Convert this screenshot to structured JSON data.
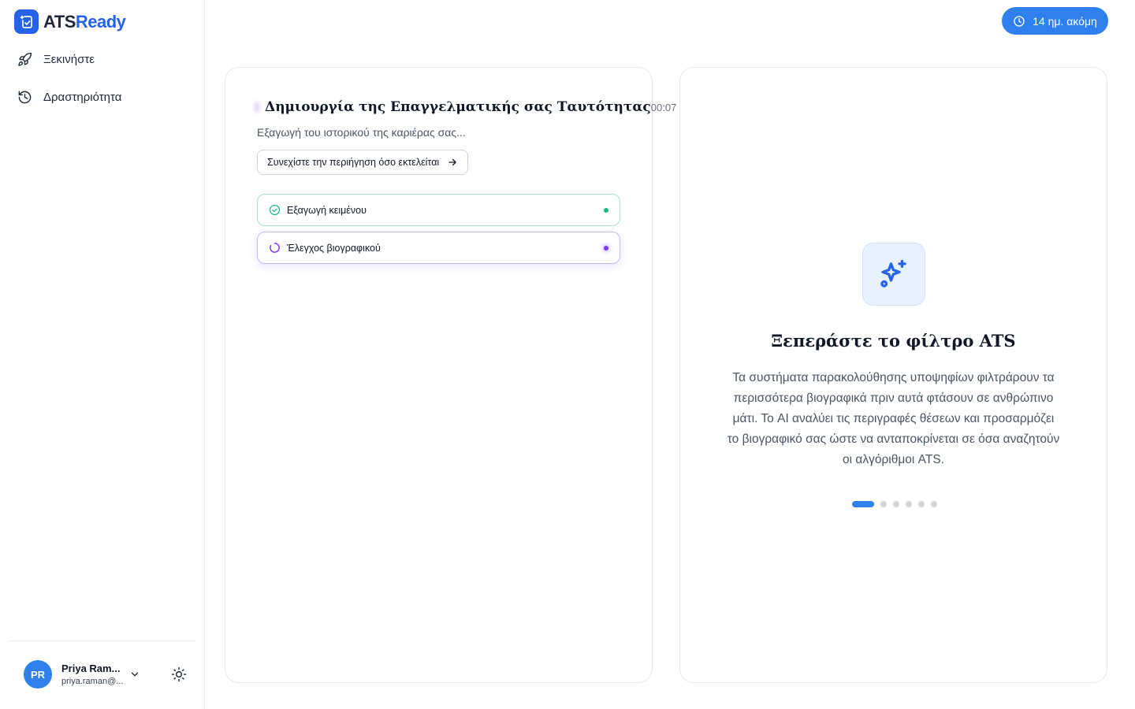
{
  "app": {
    "brand_part1": "ATS",
    "brand_part2": "Ready",
    "brand_color": "#2563eb"
  },
  "sidebar": {
    "items": [
      {
        "label": "Ξεκινήστε",
        "icon": "rocket-icon"
      },
      {
        "label": "Δραστηριότητα",
        "icon": "history-icon"
      }
    ]
  },
  "user": {
    "initials": "PR",
    "name": "Priya Ram...",
    "email": "priya.raman@..."
  },
  "trial": {
    "label": "14 ημ. ακόμη",
    "icon": "clock-icon"
  },
  "generation": {
    "title": "Δημιουργία της Επαγγελματικής σας Ταυτότητας",
    "elapsed": "00:07",
    "subtitle": "Εξαγωγή του ιστορικού της καριέρας σας...",
    "browse_label": "Συνεχίστε την περιήγηση όσο εκτελείται",
    "steps": [
      {
        "label": "Εξαγωγή κειμένου",
        "status": "done",
        "icon": "check-circle-icon"
      },
      {
        "label": "Έλεγχος βιογραφικού",
        "status": "in-progress",
        "icon": "spinner-icon"
      }
    ]
  },
  "feature": {
    "icon": "sparkles-icon",
    "title": "Ξεπεράστε το φίλτρο ATS",
    "description": "Τα συστήματα παρακολούθησης υποψηφίων φιλτράρουν τα περισσότερα βιογραφικά πριν αυτά φτάσουν σε ανθρώπινο μάτι. Το AI αναλύει τις περιγραφές θέσεων και προσαρμόζει το βιογραφικό σας ώστε να ανταποκρίνεται σε όσα αναζητούν οι αλγόριθμοι ATS.",
    "carousel_total": 6,
    "carousel_active": 1
  },
  "colors": {
    "accent": "#2f80ed",
    "progress_purple": "#7c3aed",
    "success_green": "#10b981"
  }
}
